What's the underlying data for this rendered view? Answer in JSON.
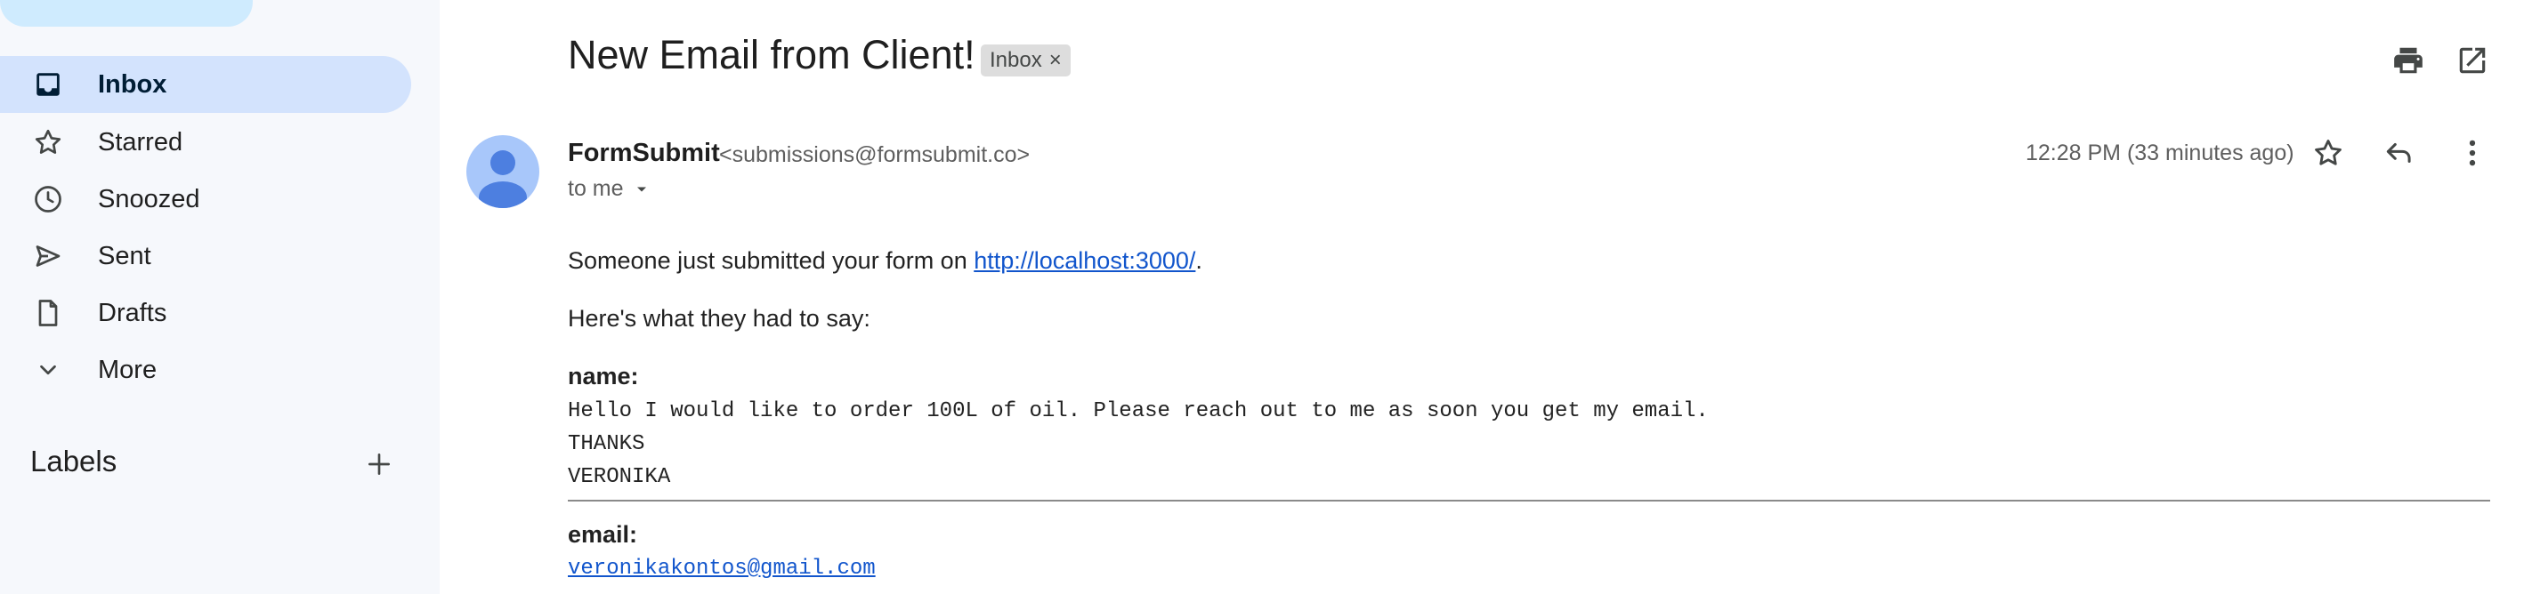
{
  "sidebar": {
    "items": [
      {
        "label": "Inbox",
        "icon": "inbox-icon",
        "active": true
      },
      {
        "label": "Starred",
        "icon": "star-icon"
      },
      {
        "label": "Snoozed",
        "icon": "clock-icon"
      },
      {
        "label": "Sent",
        "icon": "send-icon"
      },
      {
        "label": "Drafts",
        "icon": "draft-icon"
      },
      {
        "label": "More",
        "icon": "chevron-down-icon"
      }
    ],
    "labels_heading": "Labels"
  },
  "email": {
    "subject": "New Email from Client!",
    "tag": "Inbox",
    "tag_remove": "×",
    "sender_name": "FormSubmit",
    "sender_email": "<submissions@formsubmit.co>",
    "to": "to me",
    "time": "12:28 PM (33 minutes ago)",
    "intro_before": "Someone just submitted your form on ",
    "intro_link": "http://localhost:3000/",
    "intro_after": ".",
    "said": "Here's what they had to say:",
    "fields": {
      "name_label": "name:",
      "name_lines": [
        "Hello I would like to order 100L of oil. Please reach out to me as soon you get my email.",
        "THANKS",
        "VERONIKA"
      ],
      "email_label": "email:",
      "email_value": "veronikakontos@gmail.com"
    }
  },
  "colors": {
    "sidebar_bg": "#f6f8fc",
    "active_item": "#d3e3fd",
    "link": "#1155cc",
    "tag_bg": "#dddddd"
  }
}
